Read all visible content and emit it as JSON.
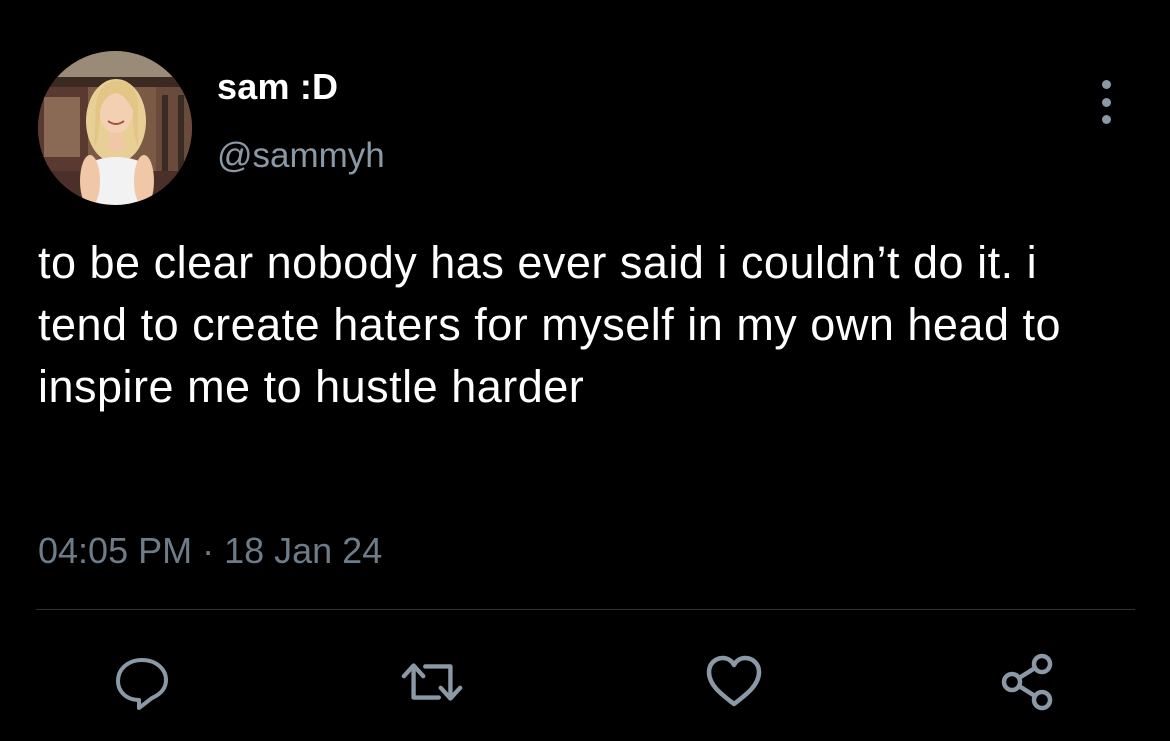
{
  "tweet": {
    "author": {
      "display_name": "sam :D",
      "handle": "@sammyh",
      "avatar_icon": "profile-photo"
    },
    "text": "to be clear nobody has ever said i couldn’t do it. i tend to create haters for myself in my own head to inspire me to hustle harder",
    "time": "04:05 PM",
    "separator": "·",
    "date": "18 Jan 24"
  },
  "actions": {
    "more_icon": "more-vertical-icon",
    "reply_icon": "reply-icon",
    "retweet_icon": "retweet-icon",
    "like_icon": "heart-icon",
    "share_icon": "share-icon"
  },
  "colors": {
    "background": "#000000",
    "primary_text": "#ffffff",
    "secondary_text": "#8b98a5",
    "divider": "#2f3336"
  }
}
